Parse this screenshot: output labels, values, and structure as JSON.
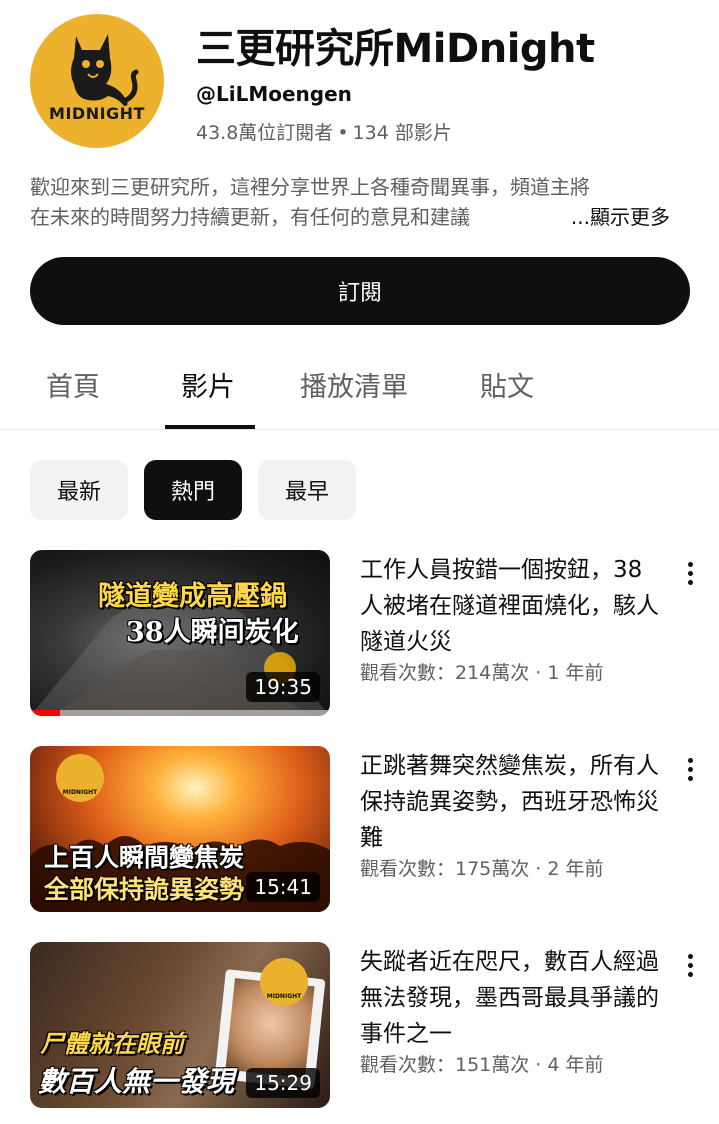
{
  "channel": {
    "logo_text": "MIDNIGHT",
    "name": "三更研究所MiDnight",
    "handle": "@LiLMoengen",
    "subscribers": "43.8萬位訂閱者",
    "separator": "•",
    "video_count": "134 部影片",
    "description_line1": "歡迎來到三更研究所，這裡分享世界上各種奇聞異事，頻道主將",
    "description_line2": "在未來的時間努力持續更新，有任何的意見和建議",
    "show_more": "...顯示更多",
    "subscribe_label": "訂閱"
  },
  "tabs": [
    {
      "label": "首頁",
      "active": false
    },
    {
      "label": "影片",
      "active": true
    },
    {
      "label": "播放清單",
      "active": false
    },
    {
      "label": "貼文",
      "active": false
    }
  ],
  "chips": [
    {
      "label": "最新",
      "active": false
    },
    {
      "label": "熱門",
      "active": true
    },
    {
      "label": "最早",
      "active": false
    }
  ],
  "videos": [
    {
      "caption_top": "隧道變成高壓鍋",
      "caption_bottom": "38人瞬间炭化",
      "duration": "19:35",
      "watched_fraction": 0.1,
      "title": "工作人員按錯一個按鈕，38人被堵在隧道裡面燒化，駭人隧道火災",
      "meta": "觀看次數：214萬次 · 1 年前"
    },
    {
      "logo_text": "MIDNIGHT",
      "caption_top": "上百人瞬間變焦炭",
      "caption_bottom": "全部保持詭異姿勢",
      "duration": "15:41",
      "title": "正跳著舞突然變焦炭，所有人保持詭異姿勢，西班牙恐怖災難",
      "meta": "觀看次數：175萬次 · 2 年前"
    },
    {
      "logo_text": "MIDNIGHT",
      "caption_top": "尸體就在眼前",
      "caption_bottom": "數百人無一發現",
      "duration": "15:29",
      "title": "失蹤者近在咫尺，數百人經過無法發現，墨西哥最具爭議的事件之一",
      "meta": "觀看次數：151萬次 · 4 年前"
    }
  ],
  "colors": {
    "brand_yellow": "#ecb22e",
    "progress_red": "#ff0000",
    "text_primary": "#0f0f0f",
    "text_secondary": "#606060"
  }
}
